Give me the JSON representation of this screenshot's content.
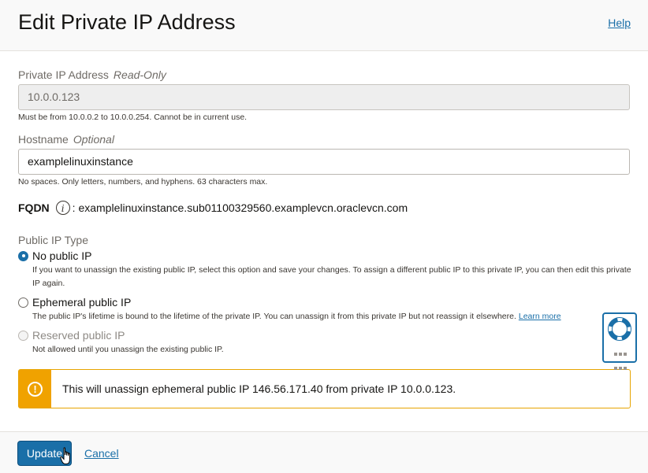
{
  "header": {
    "title": "Edit Private IP Address",
    "help_label": "Help"
  },
  "private_ip": {
    "label": "Private IP Address",
    "label_note": "Read-Only",
    "value": "10.0.0.123",
    "hint": "Must be from 10.0.0.2 to 10.0.0.254. Cannot be in current use."
  },
  "hostname": {
    "label": "Hostname",
    "label_note": "Optional",
    "value": "examplelinuxinstance",
    "hint": "No spaces. Only letters, numbers, and hyphens. 63 characters max."
  },
  "fqdn": {
    "label": "FQDN",
    "info_icon": "info-icon",
    "value": ": examplelinuxinstance.sub01100329560.examplevcn.oraclevcn.com"
  },
  "public_ip_type": {
    "label": "Public IP Type",
    "options": [
      {
        "label": "No public IP",
        "checked": true,
        "disabled": false,
        "description": "If you want to unassign the existing public IP, select this option and save your changes. To assign a different public IP to this private IP, you can then edit this private IP again."
      },
      {
        "label": "Ephemeral public IP",
        "checked": false,
        "disabled": false,
        "description": "The public IP's lifetime is bound to the lifetime of the private IP. You can unassign it from this private IP but not reassign it elsewhere.",
        "link": "Learn more"
      },
      {
        "label": "Reserved public IP",
        "checked": false,
        "disabled": true,
        "description": "Not allowed until you unassign the existing public IP."
      }
    ]
  },
  "warning": {
    "icon": "exclamation-circle-icon",
    "text": "This will unassign ephemeral public IP 146.56.171.40 from private IP 10.0.0.123."
  },
  "footer": {
    "update_label": "Update",
    "cancel_label": "Cancel"
  },
  "colors": {
    "accent": "#1a6fa8",
    "warning": "#f0a200"
  }
}
